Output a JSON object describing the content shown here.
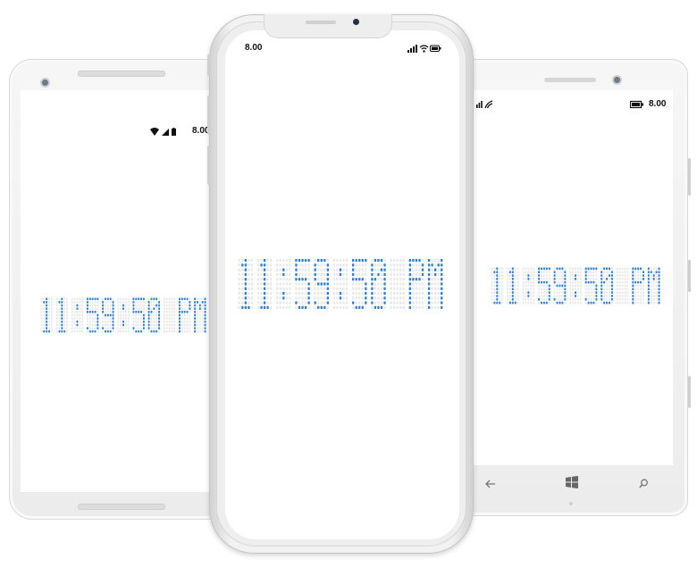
{
  "clock": {
    "text": "11:59:50 PM",
    "on_color": "#2b7fe0",
    "off_color": "#e9e9e9"
  },
  "android": {
    "status_time": "8.00",
    "icons": [
      "wifi-icon",
      "signal-icon",
      "battery-icon"
    ]
  },
  "iphone": {
    "status_time": "8.00",
    "icons": [
      "signal-icon",
      "wifi-icon",
      "battery-icon"
    ]
  },
  "winphone": {
    "status_time": "8.00",
    "icons": [
      "signal-icon",
      "wifi-icon",
      "battery-icon"
    ],
    "nav": [
      "back-icon",
      "windows-icon",
      "search-icon"
    ]
  }
}
